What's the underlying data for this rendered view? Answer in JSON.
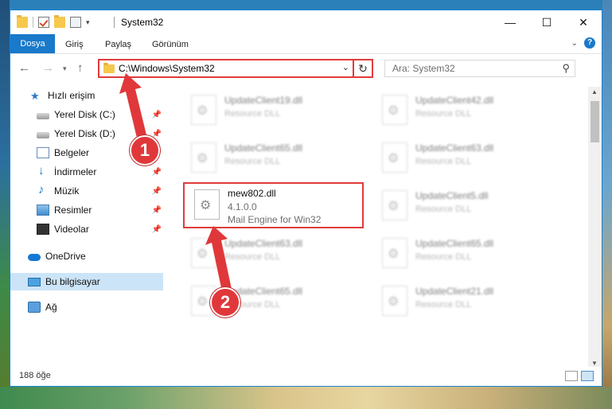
{
  "window": {
    "title": "System32",
    "controls": [
      "minimize-icon",
      "maximize-icon",
      "close-icon"
    ]
  },
  "ribbon": {
    "tabs": [
      {
        "label": "Dosya",
        "active": true
      },
      {
        "label": "Giriş"
      },
      {
        "label": "Paylaş"
      },
      {
        "label": "Görünüm"
      }
    ]
  },
  "address": {
    "path": "C:\\Windows\\System32",
    "search_placeholder": "Ara: System32"
  },
  "sidebar": {
    "items": [
      {
        "label": "Hızlı erişim",
        "icon": "star-icon"
      },
      {
        "label": "Yerel Disk (C:)",
        "icon": "disk-icon",
        "pinned": true
      },
      {
        "label": "Yerel Disk (D:)",
        "icon": "disk-icon",
        "pinned": true
      },
      {
        "label": "Belgeler",
        "icon": "documents-icon",
        "pinned": true
      },
      {
        "label": "İndirmeler",
        "icon": "downloads-icon",
        "pinned": true
      },
      {
        "label": "Müzik",
        "icon": "music-icon",
        "pinned": true
      },
      {
        "label": "Resimler",
        "icon": "pictures-icon",
        "pinned": true
      },
      {
        "label": "Videolar",
        "icon": "videos-icon",
        "pinned": true
      },
      {
        "label": "OneDrive",
        "icon": "onedrive-icon"
      },
      {
        "label": "Bu bilgisayar",
        "icon": "this-pc-icon",
        "selected": true
      },
      {
        "label": "Ağ",
        "icon": "network-icon"
      }
    ]
  },
  "files": {
    "left": [
      {
        "name": "UpdateClient19.dll",
        "desc": "Resource DLL"
      },
      {
        "name": "UpdateClient65.dll",
        "desc": "Resource DLL"
      },
      {
        "name": "UpdateClient63.dll",
        "desc": "Resource DLL"
      },
      {
        "name": "UpdateClient65.dll",
        "desc": "Resource DLL"
      }
    ],
    "right": [
      {
        "name": "UpdateClient42.dll",
        "desc": "Resource DLL"
      },
      {
        "name": "UpdateClient63.dll",
        "desc": "Resource DLL"
      },
      {
        "name": "UpdateClient5.dll",
        "desc": "Resource DLL"
      },
      {
        "name": "UpdateClient65.dll",
        "desc": "Resource DLL"
      },
      {
        "name": "UpdateClient21.dll",
        "desc": "Resource DLL"
      }
    ],
    "highlighted": {
      "name": "mew802.dll",
      "version": "4.1.0.0",
      "desc": "Mail Engine for Win32"
    }
  },
  "status": {
    "item_count": "188 öğe"
  },
  "annotations": {
    "badge1": "1",
    "badge2": "2",
    "color": "#e0383a"
  }
}
